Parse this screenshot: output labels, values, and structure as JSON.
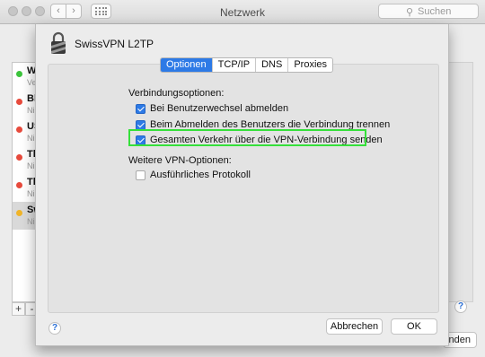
{
  "window": {
    "title": "Netzwerk",
    "search_placeholder": "Suchen",
    "search_icon": "magnifier-icon"
  },
  "background": {
    "services": [
      {
        "name": "W",
        "status": "Ve",
        "color": "#3cc43c"
      },
      {
        "name": "Bl",
        "status": "Ni",
        "color": "#e74a3c"
      },
      {
        "name": "US",
        "status": "Ni",
        "color": "#e74a3c"
      },
      {
        "name": "Th",
        "status": "Ni",
        "color": "#e74a3c"
      },
      {
        "name": "Th",
        "status": "Ni",
        "color": "#e74a3c"
      },
      {
        "name": "Sw",
        "status": "Ni",
        "color": "#f0b429"
      }
    ],
    "add_label": "+",
    "remove_label": "-",
    "help_label": "?",
    "apply_label": "Anwenden"
  },
  "sheet": {
    "vpn_name": "SwissVPN L2TP",
    "tabs": [
      {
        "label": "Optionen",
        "active": true
      },
      {
        "label": "TCP/IP",
        "active": false
      },
      {
        "label": "DNS",
        "active": false
      },
      {
        "label": "Proxies",
        "active": false
      }
    ],
    "section1_title": "Verbindungsoptionen:",
    "section1_options": [
      {
        "label": "Bei Benutzerwechsel abmelden",
        "checked": true
      },
      {
        "label": "Beim Abmelden des Benutzers die Verbindung trennen",
        "checked": true
      },
      {
        "label": "Gesamten Verkehr über die VPN-Verbindung senden",
        "checked": true,
        "highlighted": true
      }
    ],
    "section2_title": "Weitere VPN-Optionen:",
    "section2_options": [
      {
        "label": "Ausführliches Protokoll",
        "checked": false
      }
    ],
    "help_label": "?",
    "cancel_label": "Abbrechen",
    "ok_label": "OK",
    "highlight_color": "#35e03a",
    "accent_color": "#2d7ae6"
  }
}
